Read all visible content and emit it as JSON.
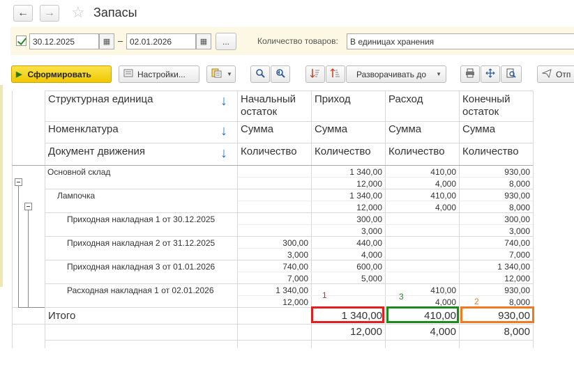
{
  "header": {
    "back_icon": "←",
    "forward_icon": "→",
    "star_icon": "☆",
    "title": "Запасы"
  },
  "filter": {
    "period_enabled": true,
    "date_from": "30.12.2025",
    "date_to": "02.01.2026",
    "date_separator": "–",
    "calendar_icon": "▦",
    "period_button": "...",
    "qty_label": "Количество товаров:",
    "qty_value": "В единицах хранения"
  },
  "toolbar": {
    "generate_label": "Сформировать",
    "settings_label": "Настройки...",
    "expand_label": "Разворачивать до",
    "send_label": "Отп"
  },
  "report": {
    "header_rows": [
      {
        "label": "Структурная единица",
        "cols": [
          "Начальный\nостаток",
          "Приход",
          "Расход",
          "Конечный\nостаток"
        ]
      },
      {
        "label": "Номенклатура",
        "cols": [
          "Сумма",
          "Сумма",
          "Сумма",
          "Сумма"
        ]
      },
      {
        "label": "Документ движения",
        "cols": [
          "Количество",
          "Количество",
          "Количество",
          "Количество"
        ]
      }
    ],
    "rows": [
      {
        "name": "Основной склад",
        "sum": [
          "",
          "1 340,00",
          "410,00",
          "930,00"
        ],
        "qty": [
          "",
          "12,000",
          "4,000",
          "8,000"
        ]
      },
      {
        "name": "Лампочка",
        "sum": [
          "",
          "1 340,00",
          "410,00",
          "930,00"
        ],
        "qty": [
          "",
          "12,000",
          "4,000",
          "8,000"
        ]
      },
      {
        "name": "Приходная накладная 1 от 30.12.2025",
        "sum": [
          "",
          "300,00",
          "",
          "300,00"
        ],
        "qty": [
          "",
          "3,000",
          "",
          "3,000"
        ]
      },
      {
        "name": "Приходная накладная 2 от 31.12.2025",
        "sum": [
          "300,00",
          "440,00",
          "",
          "740,00"
        ],
        "qty": [
          "3,000",
          "4,000",
          "",
          "7,000"
        ]
      },
      {
        "name": "Приходная накладная 3 от 01.01.2026",
        "sum": [
          "740,00",
          "600,00",
          "",
          "1 340,00"
        ],
        "qty": [
          "7,000",
          "5,000",
          "",
          "12,000"
        ]
      },
      {
        "name": "Расходная накладная 1 от 02.01.2026",
        "sum": [
          "1 340,00",
          "",
          "410,00",
          "930,00"
        ],
        "qty": [
          "12,000",
          "",
          "4,000",
          "8,000"
        ]
      }
    ],
    "total": {
      "label": "Итого",
      "sum": [
        "",
        "1 340,00",
        "410,00",
        "930,00"
      ],
      "qty": [
        "",
        "12,000",
        "4,000",
        "8,000"
      ]
    },
    "marks": [
      {
        "text": "1",
        "color": "#e02020"
      },
      {
        "text": "3",
        "color": "#1e8a1e"
      },
      {
        "text": "2",
        "color": "#f07a20"
      }
    ],
    "highlight_colors": [
      "#e02020",
      "#1e8a1e",
      "#f07a20"
    ]
  }
}
